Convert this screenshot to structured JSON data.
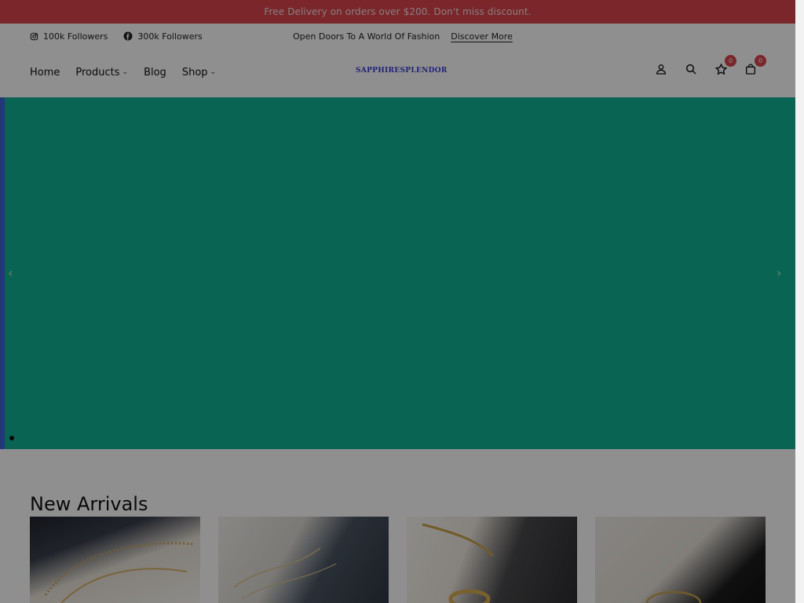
{
  "promo": {
    "text": "Free Delivery on orders over $200. Don't miss discount."
  },
  "topbar": {
    "instagram": {
      "label": "100k Followers",
      "icon": "instagram-icon"
    },
    "facebook": {
      "label": "300k Followers",
      "icon": "facebook-icon"
    },
    "message": "Open Doors To A World Of Fashion",
    "discover": "Discover More"
  },
  "nav": {
    "links": [
      {
        "label": "Home",
        "dropdown": false
      },
      {
        "label": "Products",
        "dropdown": true
      },
      {
        "label": "Blog",
        "dropdown": false
      },
      {
        "label": "Shop",
        "dropdown": true
      }
    ],
    "logo": "SAPPHIRESPLENDOR",
    "wishlist_count": "0",
    "cart_count": "0"
  },
  "hero": {
    "prev": "‹",
    "next": "›"
  },
  "new_arrivals": {
    "title": "New Arrivals"
  },
  "colors": {
    "promo": "#d9444d",
    "hero": "#12b394",
    "logo": "#3b3bd6",
    "badge": "#d9444d"
  }
}
